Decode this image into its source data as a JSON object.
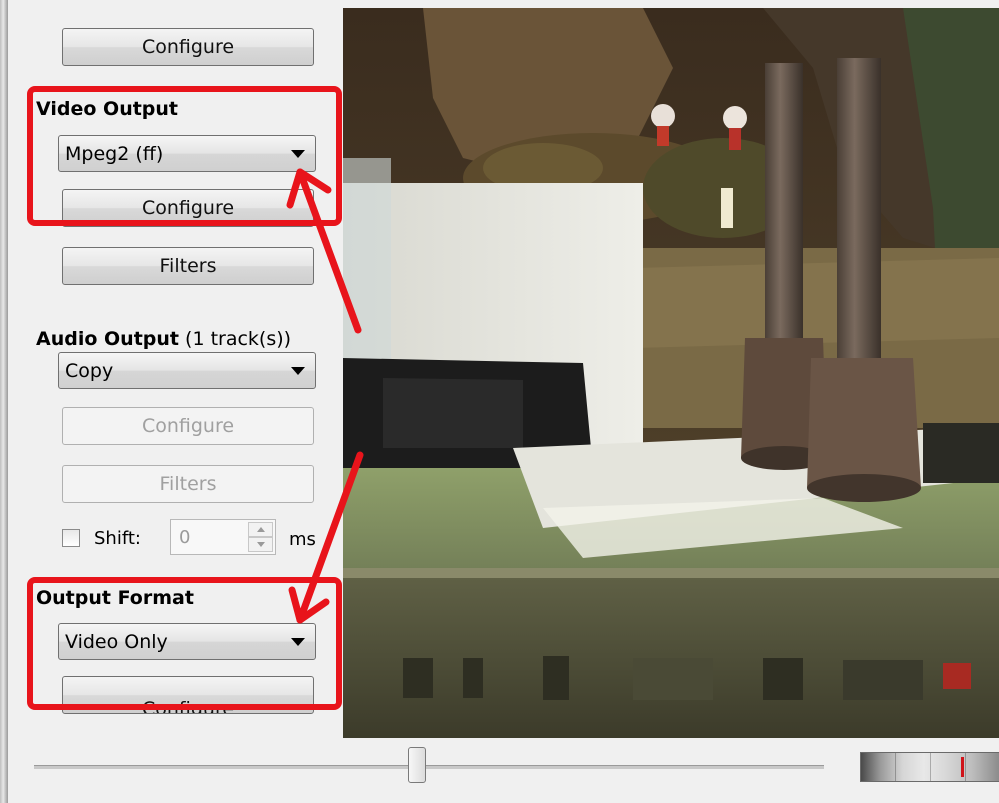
{
  "video_codec_section": {
    "configure_label": "Configure",
    "title": "Video Output",
    "encoder_value": "Mpeg2 (ff)",
    "encoder_configure_label": "Configure",
    "filters_label": "Filters"
  },
  "audio_section": {
    "title": "Audio Output",
    "track_info": "(1 track(s))",
    "encoder_value": "Copy",
    "configure_label": "Configure",
    "filters_label": "Filters",
    "shift_label": "Shift:",
    "shift_value": "0",
    "shift_unit": "ms"
  },
  "output_format_section": {
    "title": "Output Format",
    "format_value": "Video Only",
    "configure_label": "Configure"
  },
  "colors": {
    "highlight": "#e8141b",
    "panel_bg": "#f0f0f0"
  },
  "icons": [
    "dropdown-arrow-icon",
    "red-arrow-annotation-icon",
    "spin-up-icon",
    "spin-down-icon"
  ]
}
